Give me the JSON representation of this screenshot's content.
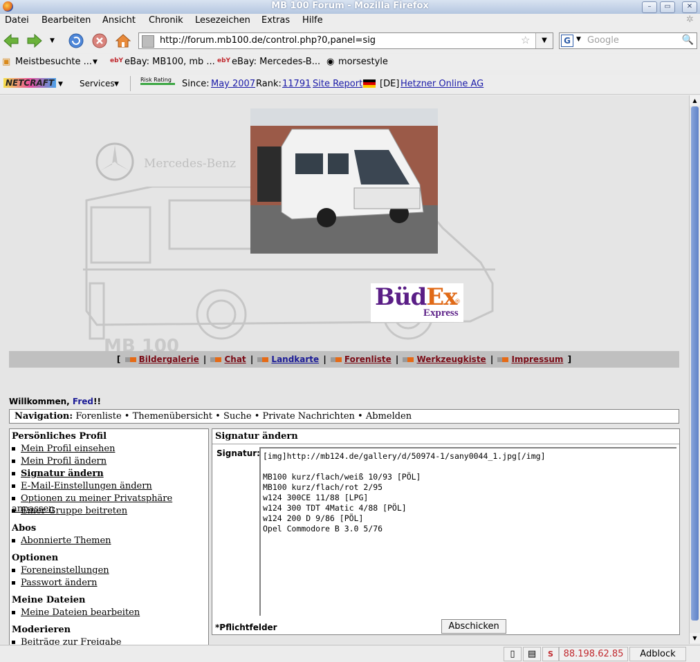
{
  "window": {
    "title": "MB 100 Forum - Mozilla Firefox"
  },
  "menu": [
    "Datei",
    "Bearbeiten",
    "Ansicht",
    "Chronik",
    "Lesezeichen",
    "Extras",
    "Hilfe"
  ],
  "urlbar": {
    "url": "http://forum.mb100.de/control.php?0,panel=sig"
  },
  "search": {
    "placeholder": "Google",
    "engine_letter": "G"
  },
  "bookmarks": [
    "Meistbesuchte ...",
    "eBay: MB100, mb ...",
    "eBay: Mercedes-B...",
    "morsestyle"
  ],
  "netcraft": {
    "logo": "NETCRAFT",
    "services": "Services",
    "risk": "Risk Rating",
    "since_label": "Since:",
    "since_value": "May 2007",
    "rank_label": "Rank:",
    "rank_value": "11791",
    "site_report": "Site Report",
    "country": "[DE]",
    "host": "Hetzner Online AG"
  },
  "banner": {
    "brand": "Mercedes-Benz",
    "model": "MB 100",
    "budex_name": "BüdEx",
    "budex_sub": "Express"
  },
  "topnav": [
    "Bildergalerie",
    "Chat",
    "Landkarte",
    "Forenliste",
    "Werkzeugkiste",
    "Impressum"
  ],
  "welcome": {
    "prefix": "Willkommen,",
    "user": "Fred",
    "suffix": "!!"
  },
  "navigation": {
    "label": "Navigation:",
    "items": [
      "Forenliste",
      "Themenübersicht",
      "Suche",
      "Private Nachrichten",
      "Abmelden"
    ]
  },
  "left": {
    "sections": [
      {
        "title": "Persönliches Profil",
        "items": [
          "Mein Profil einsehen",
          "Mein Profil ändern",
          "Signatur ändern",
          "E-Mail-Einstellungen ändern",
          "Optionen zu meiner Privatsphäre anpassen",
          "Einer Gruppe beitreten"
        ]
      },
      {
        "title": "Abos",
        "items": [
          "Abonnierte Themen"
        ]
      },
      {
        "title": "Optionen",
        "items": [
          "Foreneinstellungen",
          "Passwort ändern"
        ]
      },
      {
        "title": "Meine Dateien",
        "items": [
          "Meine Dateien bearbeiten"
        ]
      },
      {
        "title": "Moderieren",
        "items": [
          "Beiträge zur Freigabe"
        ]
      }
    ]
  },
  "panel": {
    "title": "Signatur ändern",
    "sig_label": "Signatur:",
    "sig_lines": [
      "[img]http://mb124.de/gallery/d/50974-1/sany0044_1.jpg[/img]",
      "",
      "MB100 kurz/flach/weiß 10/93 [PÖL]",
      "MB100 kurz/flach/rot 2/95",
      "w124 300CE 11/88 [LPG]",
      "w124 300 TDT 4Matic 4/88 [PÖL]",
      "w124 200 D 9/86 [PÖL]",
      "Opel Commodore B 3.0 5/76"
    ],
    "required": "*Pflichtfelder",
    "submit": "Abschicken"
  },
  "status": {
    "ip": "88.198.62.85",
    "adblock": "Adblock"
  },
  "colors": {
    "link_dark_red": "#7a0b16",
    "link_blue": "#1a1aa8",
    "budex_purple": "#5a1e86",
    "budex_orange": "#e06a17"
  }
}
